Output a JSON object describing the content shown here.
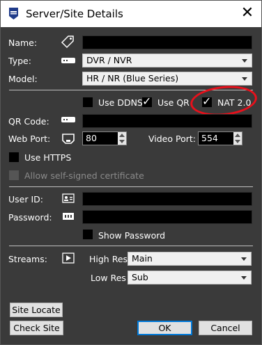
{
  "window": {
    "title": "Server/Site Details",
    "close_glyph": "✕"
  },
  "labels": {
    "name": "Name:",
    "type": "Type:",
    "model": "Model:",
    "qr_code": "QR Code:",
    "web_port": "Web Port:",
    "video_port": "Video Port:",
    "user_id": "User ID:",
    "password": "Password:",
    "streams": "Streams:",
    "high_res": "High Res",
    "low_res": "Low Res"
  },
  "fields": {
    "name_value": "",
    "qr_value": "",
    "user_id_value": "",
    "password_value": "",
    "type_selected": "DVR / NVR",
    "model_selected": "HR / NR (Blue Series)",
    "web_port_value": "80",
    "video_port_value": "554",
    "high_res_selected": "Main",
    "low_res_selected": "Sub"
  },
  "checkboxes": {
    "use_ddns": {
      "label": "Use DDNS",
      "checked": false
    },
    "use_qr": {
      "label": "Use QR",
      "checked": true
    },
    "qr_glyph": "✓",
    "nat": {
      "label": "NAT 2.0",
      "checked": true
    },
    "nat_glyph": "✓",
    "use_https": {
      "label": "Use HTTPS",
      "checked": false
    },
    "allow_self_signed": {
      "label": "Allow self-signed certificate",
      "checked": false,
      "disabled": true
    },
    "show_password": {
      "label": "Show Password",
      "checked": false
    }
  },
  "buttons": {
    "site_locate": "Site Locate",
    "check_site": "Check Site",
    "ok": "OK",
    "cancel": "Cancel"
  },
  "annotation": {
    "color": "#e8101b"
  },
  "icons": [
    "app-logo-icon",
    "tag-icon",
    "dvr-device-icon",
    "qr-device-icon",
    "port-icon",
    "id-card-icon",
    "password-icon",
    "play-icon"
  ]
}
